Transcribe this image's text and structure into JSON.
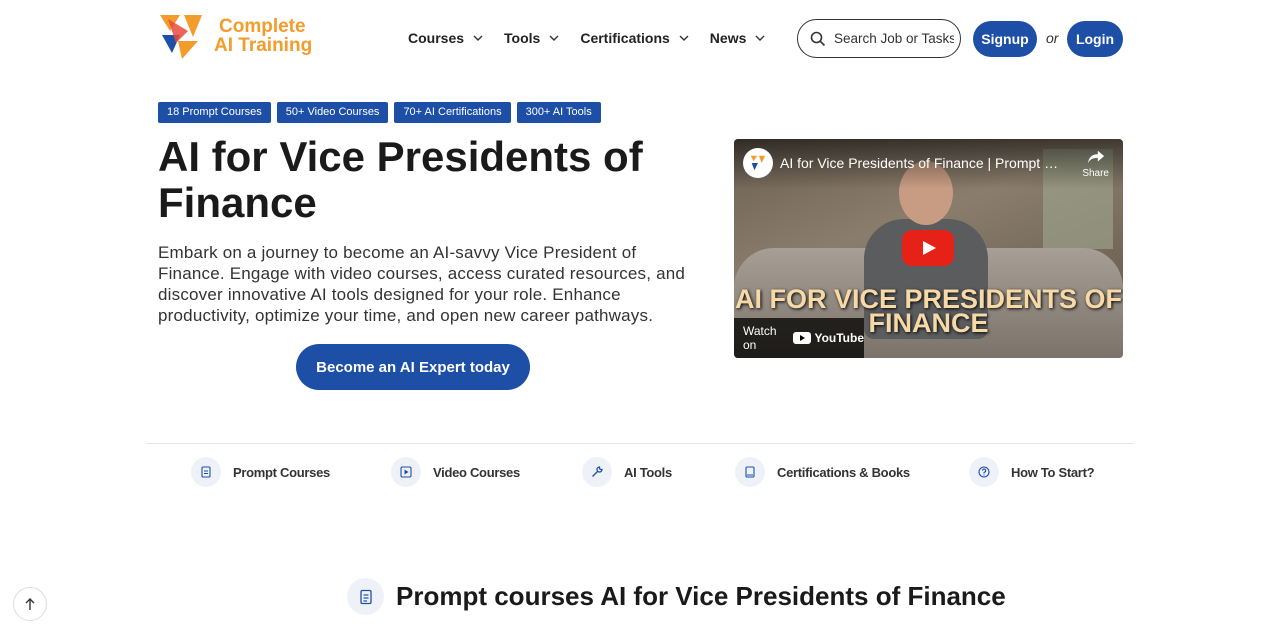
{
  "logo": {
    "line1": "Complete",
    "line2": "AI Training"
  },
  "nav": [
    {
      "label": "Courses"
    },
    {
      "label": "Tools"
    },
    {
      "label": "Certifications"
    },
    {
      "label": "News"
    }
  ],
  "search": {
    "placeholder": "Search Job or Tasks"
  },
  "auth": {
    "signup": "Signup",
    "or": "or",
    "login": "Login"
  },
  "badges": [
    "18 Prompt Courses",
    "50+ Video Courses",
    "70+ AI Certifications",
    "300+ AI Tools"
  ],
  "hero": {
    "title": "AI for Vice Presidents of Finance",
    "description": "Embark on a journey to become an AI-savvy Vice President of Finance. Engage with video courses, access curated resources, and discover innovative AI tools designed for your role. Enhance productivity, optimize your time, and open new career pathways.",
    "cta": "Become an AI Expert today"
  },
  "video": {
    "title": "AI for Vice Presidents of Finance | Prompt & ...",
    "share": "Share",
    "overlay_line1": "AI FOR VICE PRESIDENTS OF",
    "overlay_line2": "FINANCE",
    "watch_on": "Watch on",
    "youtube": "YouTube"
  },
  "categories": [
    {
      "label": "Prompt Courses",
      "icon": "document-icon"
    },
    {
      "label": "Video Courses",
      "icon": "play-icon"
    },
    {
      "label": "AI Tools",
      "icon": "wrench-icon"
    },
    {
      "label": "Certifications & Books",
      "icon": "book-icon"
    },
    {
      "label": "How To Start?",
      "icon": "question-icon"
    }
  ],
  "section": {
    "title": "Prompt courses AI for Vice Presidents of Finance",
    "icon": "document-icon"
  },
  "colors": {
    "primary": "#1d4fa7",
    "logo_orange": "#f39c2b"
  }
}
